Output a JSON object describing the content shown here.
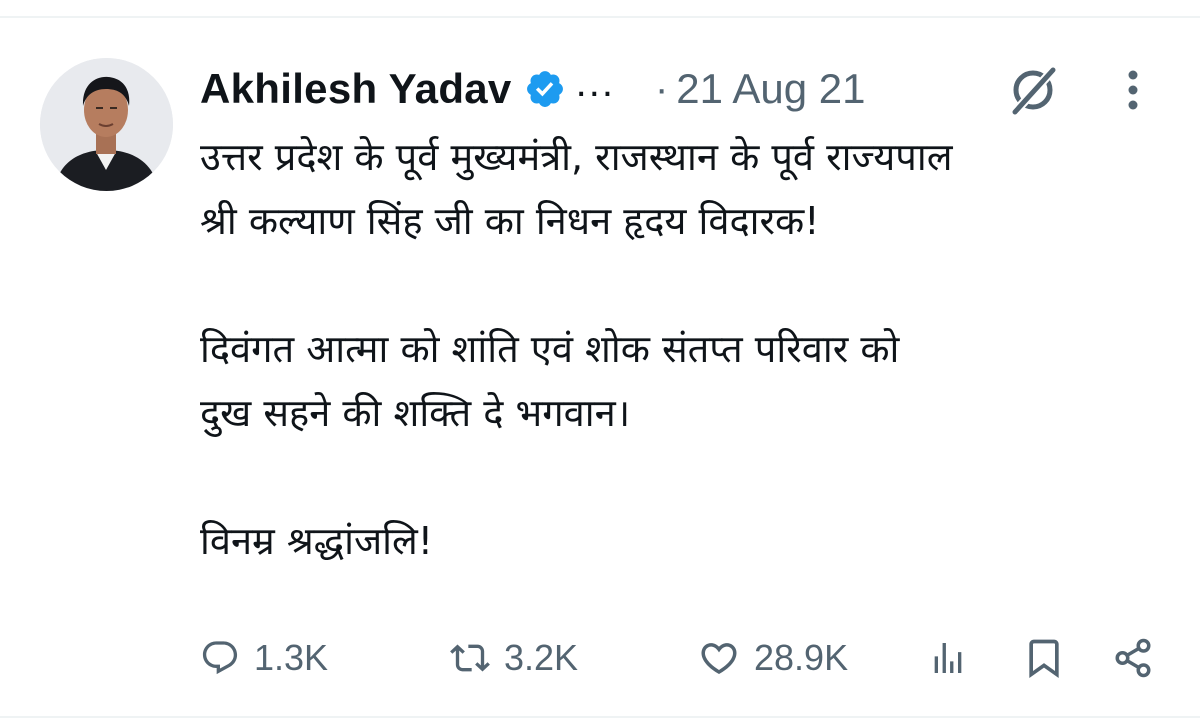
{
  "author": {
    "name": "Akhilesh Yadav",
    "verified": true,
    "more_names": "...",
    "separator": "·",
    "date": "21 Aug 21"
  },
  "tweet": {
    "paragraphs": [
      [
        "उत्तर प्रदेश के पूर्व मुख्यमंत्री, राजस्थान के पूर्व राज्यपाल",
        "श्री कल्याण सिंह जी का निधन हृदय विदारक!"
      ],
      [
        "दिवंगत आत्मा को शांति एवं शोक संतप्त परिवार को",
        "दुख सहने की शक्ति दे भगवान।"
      ],
      [
        "विनम्र श्रद्धांजलि!"
      ]
    ]
  },
  "actions": {
    "replies": "1.3K",
    "reposts": "3.2K",
    "likes": "28.9K"
  },
  "icons": {
    "verified": "verified-badge-icon",
    "grok": "grok-icon",
    "more": "more-vertical-icon",
    "reply": "reply-icon",
    "repost": "repost-icon",
    "like": "heart-icon",
    "views": "views-icon",
    "bookmark": "bookmark-icon",
    "share": "share-icon"
  },
  "colors": {
    "text": "#0f1419",
    "muted": "#536471",
    "verified": "#1d9bf0",
    "divider": "#eff3f4"
  }
}
